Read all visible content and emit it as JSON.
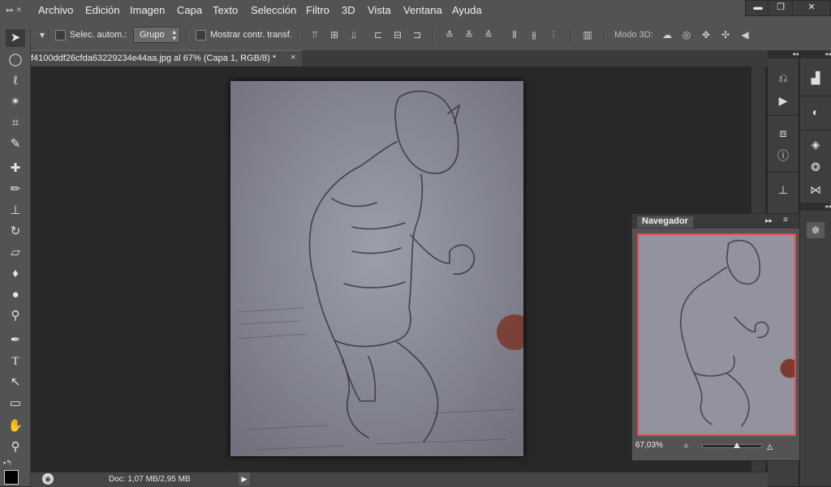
{
  "menu": {
    "items": [
      "Archivo",
      "Edición",
      "Imagen",
      "Capa",
      "Texto",
      "Selección",
      "Filtro",
      "3D",
      "Vista",
      "Ventana",
      "Ayuda"
    ]
  },
  "window_controls": {
    "minimize": "▬",
    "restore": "❐",
    "close": "✕"
  },
  "options": {
    "auto_select_label": "Selec. autom.:",
    "group_value": "Grupo",
    "show_transform_label": "Mostrar contr. transf.",
    "mode_3d_label": "Modo 3D:"
  },
  "document_tab": {
    "title": "f4100ddf26cfda63229234e44aa.jpg al 67% (Capa 1, RGB/8) *",
    "close": "×"
  },
  "status": {
    "doc_info": "Doc: 1,07 MB/2,95 MB",
    "arrow": "▶"
  },
  "navigator": {
    "title": "Navegador",
    "zoom": "67,03%",
    "zoom_fraction": 0.58
  },
  "colors": {
    "ui_gray": "#535353",
    "canvas_bg": "#282828",
    "navigator_frame": "#e34a4a"
  },
  "icons": {
    "toolbar": [
      "move-icon",
      "marquee-icon",
      "lasso-icon",
      "magic-wand-icon",
      "crop-icon",
      "eyedropper-icon",
      "healing-brush-icon",
      "brush-icon",
      "clone-stamp-icon",
      "history-brush-icon",
      "eraser-icon",
      "paint-bucket-icon",
      "blur-icon",
      "dodge-icon",
      "pen-icon",
      "type-icon",
      "path-selection-icon",
      "shape-icon",
      "hand-icon",
      "zoom-icon"
    ]
  }
}
